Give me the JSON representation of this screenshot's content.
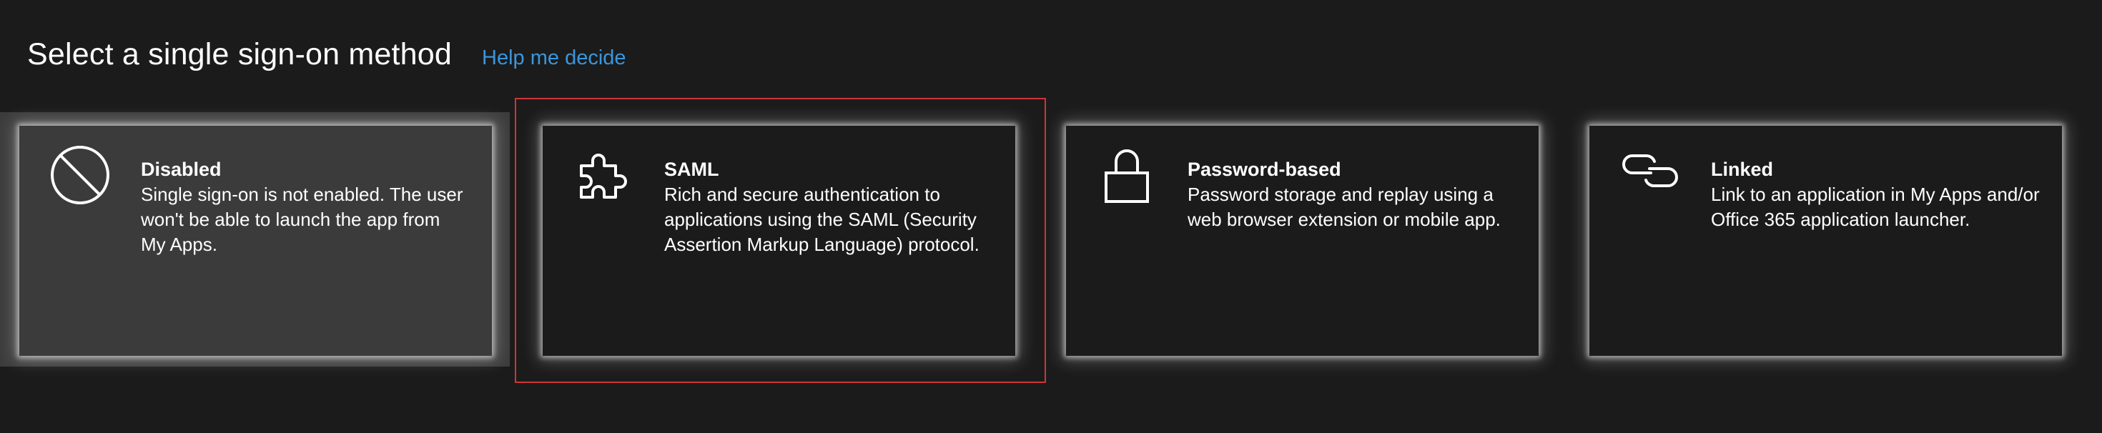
{
  "header": {
    "title": "Select a single sign-on method",
    "help_link": "Help me decide"
  },
  "colors": {
    "background": "#1b1b1b",
    "selected_card": "#3b3b3b",
    "link": "#3a96dd",
    "highlight_border": "#d13438"
  },
  "cards": [
    {
      "icon": "disabled-icon",
      "title": "Disabled",
      "description": "Single sign-on is not enabled. The user won't be able to launch the app from My Apps.",
      "selected": true
    },
    {
      "icon": "puzzle-icon",
      "title": "SAML",
      "description": "Rich and secure authentication to applications using the SAML (Security Assertion Markup Language) protocol.",
      "selected": false
    },
    {
      "icon": "lock-icon",
      "title": "Password-based",
      "description": "Password storage and replay using a web browser extension or mobile app.",
      "selected": false
    },
    {
      "icon": "link-icon",
      "title": "Linked",
      "description": "Link to an application in My Apps and/or Office 365 application launcher.",
      "selected": false
    }
  ]
}
